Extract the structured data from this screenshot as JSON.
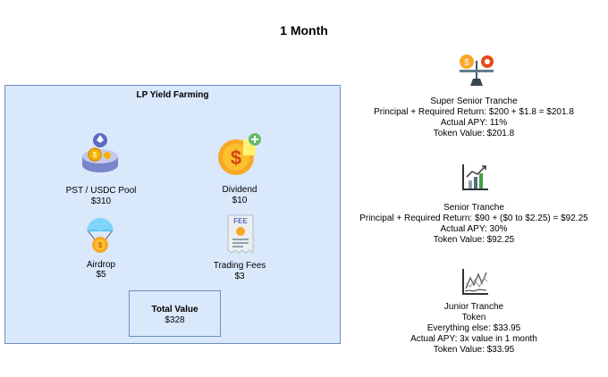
{
  "title": "1 Month",
  "lp": {
    "title": "LP Yield Farming",
    "pool": {
      "label": "PST / USDC Pool",
      "value": "$310",
      "icon": "coin-pool-icon"
    },
    "dividend": {
      "label": "Dividend",
      "value": "$10",
      "icon": "dividend-icon"
    },
    "airdrop": {
      "label": "Airdrop",
      "value": "$5",
      "icon": "airdrop-parachute-icon"
    },
    "fees": {
      "label": "Trading Fees",
      "value": "$3",
      "icon": "fee-receipt-icon"
    },
    "total": {
      "label": "Total Value",
      "value": "$328"
    }
  },
  "tranches": {
    "super_senior": {
      "icon": "balance-scale-icon",
      "lines": [
        "Super Senior Tranche",
        "Principal + Required Return: $200 + $1.8 = $201.8",
        "Actual APY: 11%",
        "Token Value: $201.8"
      ]
    },
    "senior": {
      "icon": "growth-chart-icon",
      "lines": [
        "Senior Tranche",
        "Principal + Required Return: $90 + ($0 to $2.25) = $92.25",
        "Actual APY: 30%",
        "Token Value: $92.25"
      ]
    },
    "junior": {
      "icon": "volatile-chart-icon",
      "lines": [
        "Junior Tranche",
        "Token",
        "Everything else: $33.95",
        "Actual APY: 3x value in 1 month",
        "Token Value: $33.95"
      ]
    }
  },
  "colors": {
    "box_fill": "#dae8fc",
    "box_border": "#6c8ebf"
  }
}
